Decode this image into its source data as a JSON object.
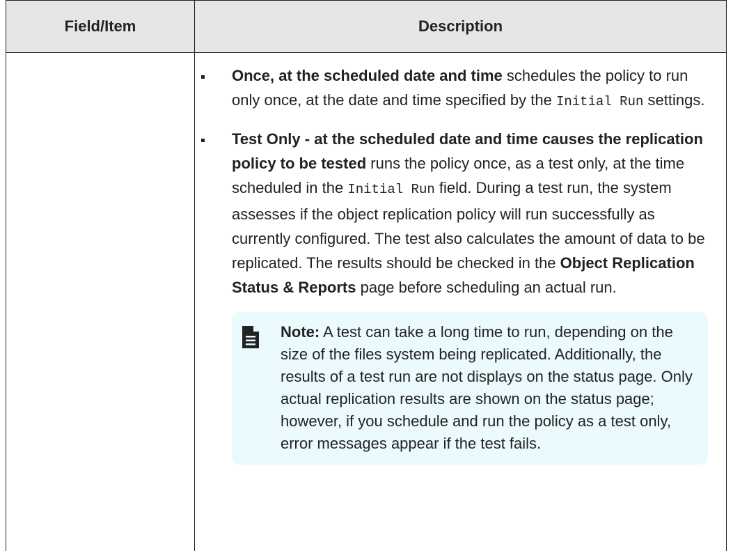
{
  "table": {
    "headers": {
      "field": "Field/Item",
      "description": "Description"
    }
  },
  "items": [
    {
      "bold": "Once, at the scheduled date and time",
      "text1": " schedules the policy to run only once, at the date and time specified by the ",
      "code": "Initial Run",
      "text2": " settings."
    },
    {
      "bold1": "Test Only",
      "sep": " - ",
      "bold2": "at the scheduled date and time causes the replication policy to be tested",
      "text1": " runs the policy once, as a test only, at the time scheduled in the ",
      "code": "Initial Run",
      "text2": " field. During a test run, the system assesses if the object replication policy will run successfully as currently configured. The test also calculates the amount of data to be replicated. The results should be checked in the ",
      "link_bold": "Object Replication Status & Reports",
      "text3": " page before scheduling an actual run."
    }
  ],
  "note": {
    "label": "Note:",
    "text": " A test can take a long time to run, depending on the size of the files system being replicated. Additionally, the results of a test run are not displays on the status page. Only actual replication results are shown on the status page; however, if you schedule and run the policy as a test only, error messages appear if the test fails.",
    "icon": "note-document-icon"
  }
}
